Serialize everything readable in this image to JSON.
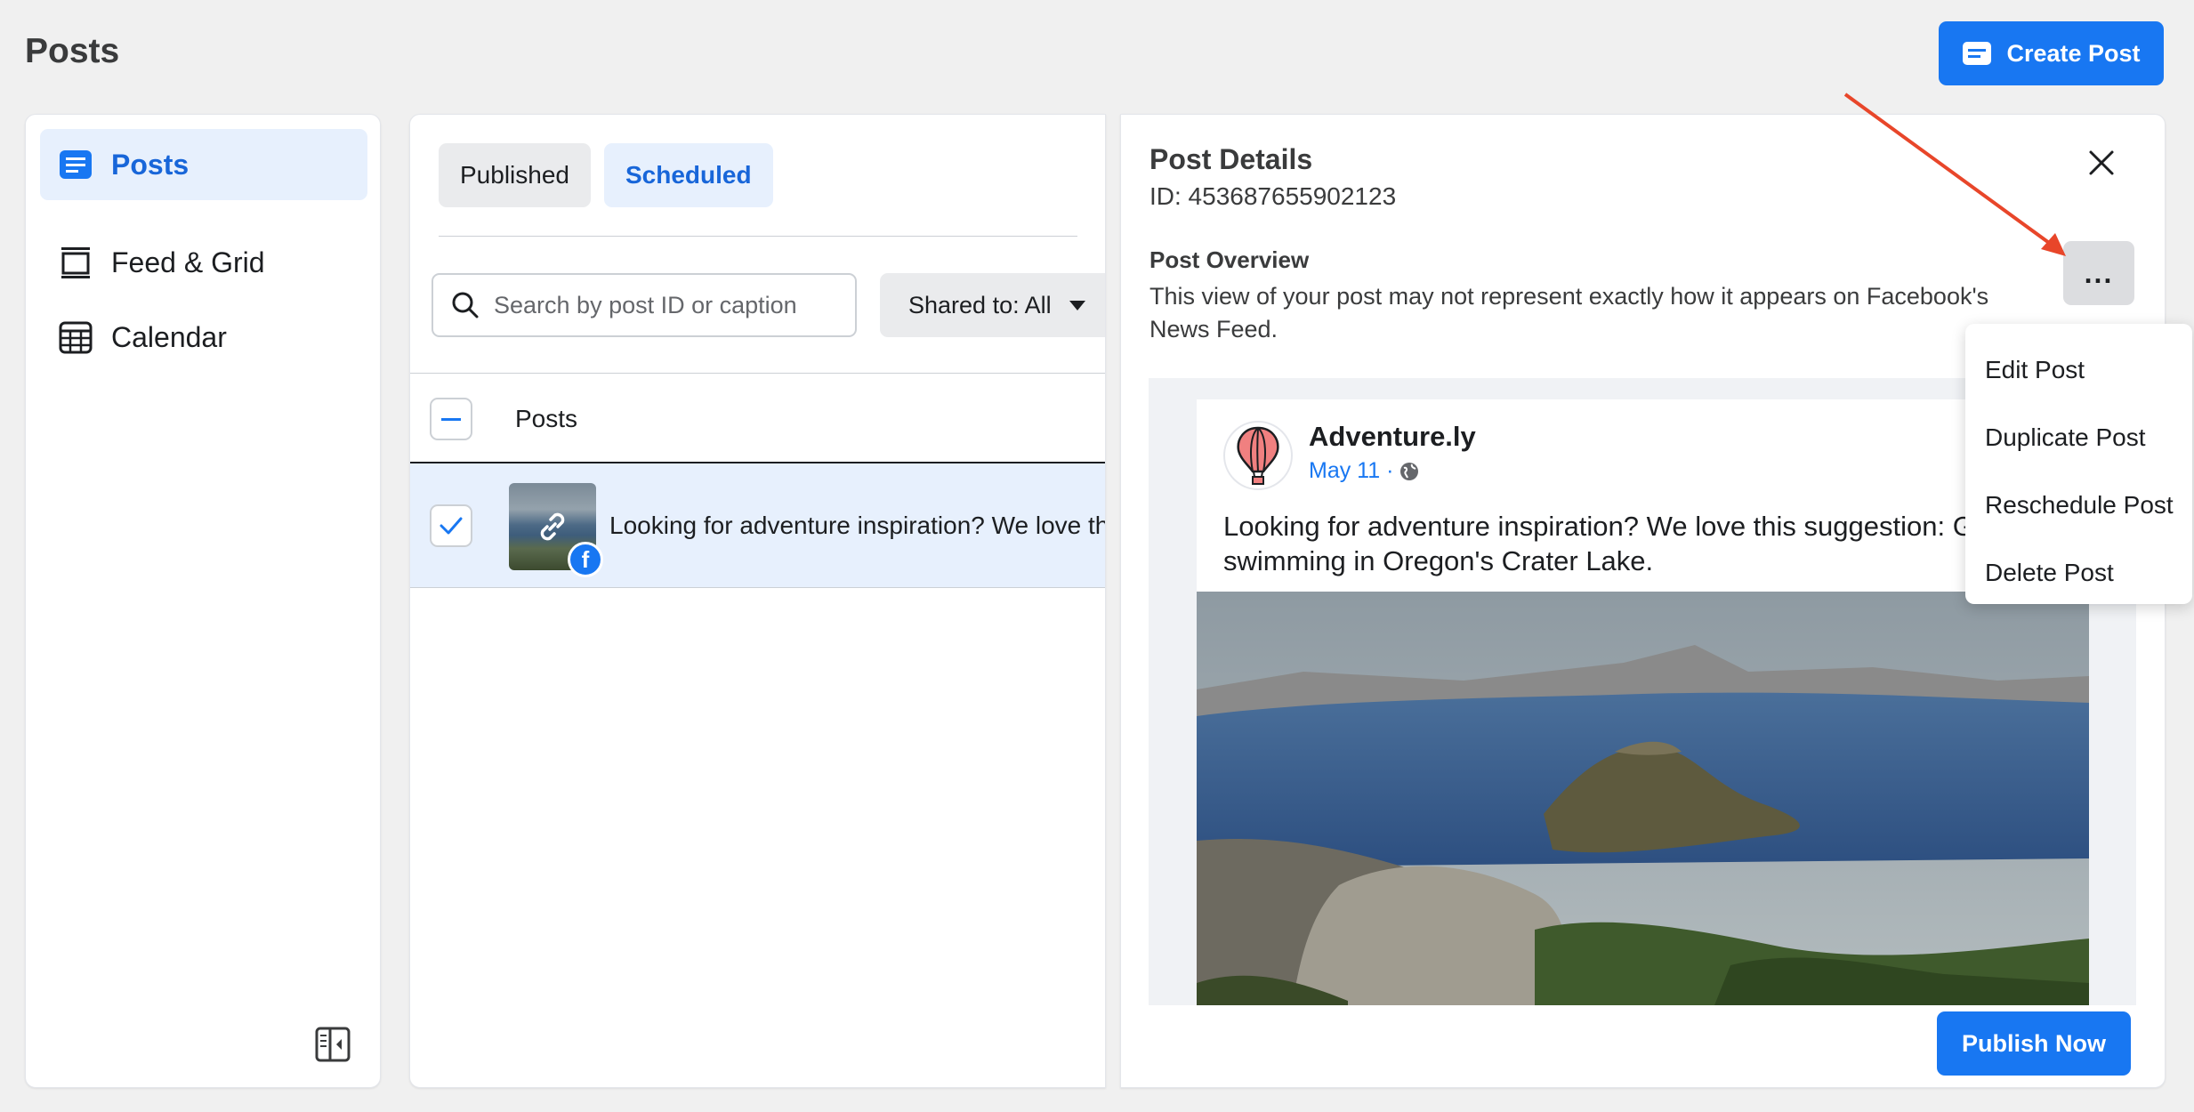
{
  "header": {
    "page_title": "Posts",
    "create_post_label": "Create Post"
  },
  "sidebar": {
    "items": [
      {
        "label": "Posts",
        "icon": "posts-icon",
        "active": true
      },
      {
        "label": "Feed & Grid",
        "icon": "feed-grid-icon",
        "active": false
      },
      {
        "label": "Calendar",
        "icon": "calendar-icon",
        "active": false
      }
    ]
  },
  "list": {
    "tabs": [
      {
        "label": "Published",
        "active": false
      },
      {
        "label": "Scheduled",
        "active": true
      }
    ],
    "search": {
      "placeholder": "Search by post ID or caption",
      "value": ""
    },
    "shared_filter_label": "Shared to: All",
    "column_header": "Posts",
    "rows": [
      {
        "caption": "Looking for adventure inspiration? We love this suggestion: Go swimming in Oregon's Crater Lake.",
        "selected": true,
        "platform": "facebook"
      }
    ]
  },
  "details": {
    "title": "Post Details",
    "id_text": "ID: 453687655902123",
    "overview_title": "Post Overview",
    "overview_text": "This view of your post may not represent exactly how it appears on Facebook's News Feed.",
    "more_label": "...",
    "preview": {
      "author": "Adventure.ly",
      "date": "May 11 ·",
      "text": "Looking for adventure inspiration? We love this suggestion: Go swimming in Oregon's Crater Lake."
    },
    "publish_label": "Publish Now"
  },
  "menu": {
    "items": [
      "Edit Post",
      "Duplicate Post",
      "Reschedule Post",
      "Delete Post"
    ]
  },
  "colors": {
    "accent": "#1877f2",
    "active_bg": "#e7f0fd",
    "annotation_arrow": "#e8462a"
  }
}
